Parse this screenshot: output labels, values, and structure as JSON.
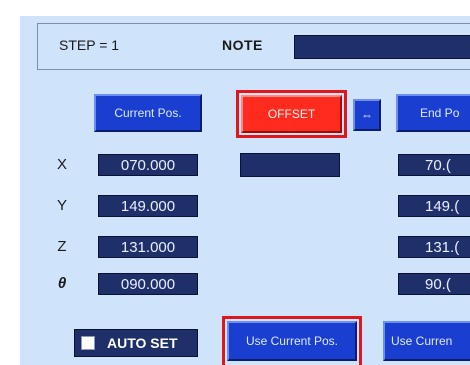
{
  "header": {
    "step_label": "STEP = 1",
    "note_label": "NOTE",
    "note_value": ""
  },
  "buttons": {
    "current_pos": "Current Pos.",
    "offset": "OFFSET",
    "swap_arrow": "⇔",
    "end_pos": "End Po",
    "use_current_pos": "Use Current Pos.",
    "use_current_2": "Use Curren"
  },
  "axes": [
    {
      "label": "X",
      "current": "070.000",
      "end": "70.("
    },
    {
      "label": "Y",
      "current": "149.000",
      "end": "149.("
    },
    {
      "label": "Z",
      "current": "131.000",
      "end": "131.("
    },
    {
      "label": "θ",
      "current": "090.000",
      "end": "90.("
    }
  ],
  "offset_value": "",
  "auto_set": {
    "label": "AUTO SET",
    "checked": false
  },
  "colors": {
    "panel_background": "#cfe4fa",
    "button_blue": "#1a3fd0",
    "field_navy": "#1f2f6a",
    "offset_red": "#ff2b1f",
    "highlight_red": "#e0161b"
  }
}
